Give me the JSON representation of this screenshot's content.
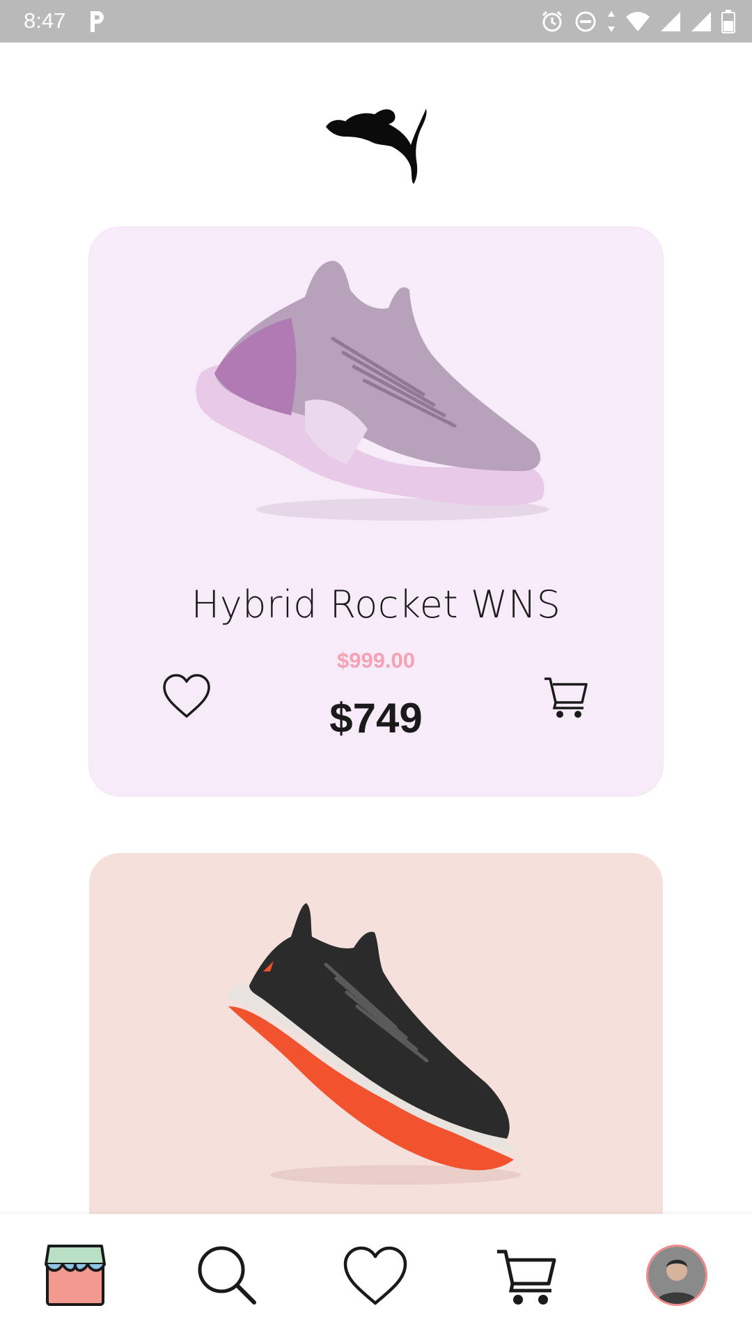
{
  "status_bar": {
    "time": "8:47",
    "icons": [
      "p-app-icon",
      "alarm-icon",
      "do-not-disturb-icon",
      "data-arrows-icon",
      "wifi-icon",
      "signal-icon",
      "signal-icon",
      "battery-icon"
    ]
  },
  "brand": {
    "logo": "puma-logo"
  },
  "products": [
    {
      "name": "Hybrid Rocket WNS",
      "old_price": "$999.00",
      "price": "$749",
      "card_color": "#f7ebf9",
      "image": "pink-sneaker"
    },
    {
      "name": "",
      "card_color": "#f6e0dc",
      "image": "black-orange-sneaker"
    }
  ],
  "colors": {
    "old_price": "#f5a3b4",
    "status_bar": "#b9b9b9",
    "avatar_ring": "#f08a8a"
  },
  "bottom_nav": {
    "items": [
      "store-icon",
      "search-icon",
      "heart-icon",
      "cart-icon",
      "avatar"
    ]
  }
}
